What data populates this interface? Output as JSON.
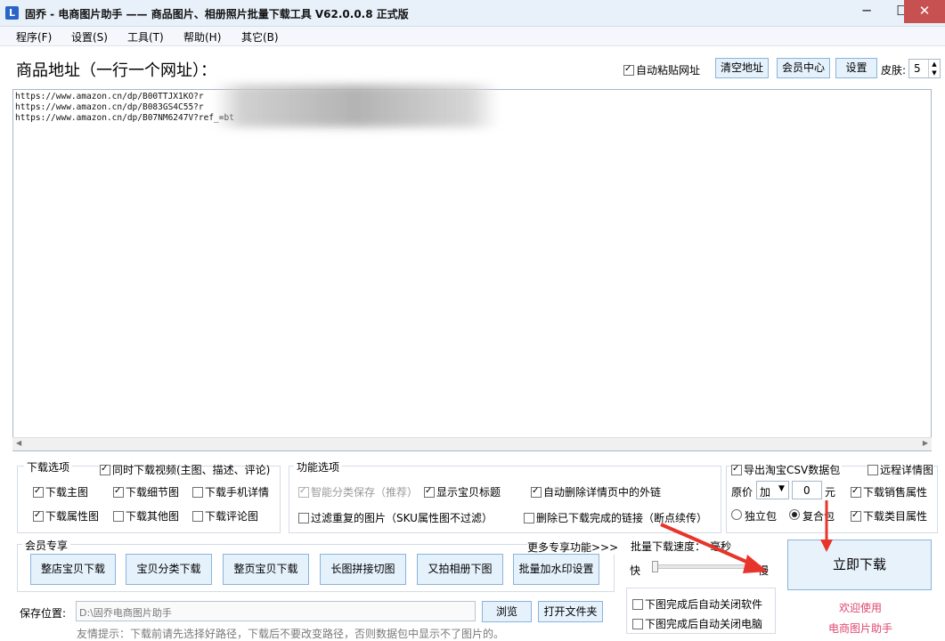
{
  "window": {
    "icon_letter": "L",
    "title": "固乔 - 电商图片助手 —— 商品图片、相册照片批量下载工具 V62.0.0.8 正式版",
    "minimize": "─",
    "maximize": "☐",
    "close": "✕"
  },
  "menu": [
    "程序(F)",
    "设置(S)",
    "工具(T)",
    "帮助(H)",
    "其它(B)"
  ],
  "url_section": {
    "label": "商品地址（一行一个网址）：",
    "auto_paste_label": "自动粘贴网址",
    "auto_paste_checked": true,
    "clear_button": "清空地址",
    "member_button": "会员中心",
    "settings_button": "设置",
    "skin_label": "皮肤:",
    "skin_value": "5",
    "urls": [
      "https://www.amazon.cn/dp/B00TTJX1KO?r",
      "https://www.amazon.cn/dp/B083GS4C55?r",
      "https://www.amazon.cn/dp/B07NM6247V?ref_=bt"
    ]
  },
  "download_options": {
    "title": "下载选项",
    "items": [
      {
        "label": "同时下载视频(主图、描述、评论)",
        "checked": true
      },
      {
        "label": "下载主图",
        "checked": true
      },
      {
        "label": "下载细节图",
        "checked": true
      },
      {
        "label": "下载手机详情",
        "checked": false
      },
      {
        "label": "下载属性图",
        "checked": true
      },
      {
        "label": "下载其他图",
        "checked": false
      },
      {
        "label": "下载评论图",
        "checked": false
      }
    ]
  },
  "function_options": {
    "title": "功能选项",
    "items": [
      {
        "label": "智能分类保存（推荐）",
        "checked": true,
        "disabled": true
      },
      {
        "label": "显示宝贝标题",
        "checked": true
      },
      {
        "label": "自动删除详情页中的外链",
        "checked": true
      },
      {
        "label": "过滤重复的图片（SKU属性图不过滤）",
        "checked": false
      },
      {
        "label": "删除已下载完成的链接（断点续传）",
        "checked": false
      }
    ]
  },
  "export_options": {
    "export_csv": {
      "label": "导出淘宝CSV数据包",
      "checked": true
    },
    "remote_detail": {
      "label": "远程详情图",
      "checked": false
    },
    "price_label": "原价",
    "price_op": "加",
    "price_value": "0",
    "price_unit": "元",
    "sales_attr": {
      "label": "下载销售属性",
      "checked": true
    },
    "standalone": {
      "label": "独立包",
      "selected": false
    },
    "composite": {
      "label": "复合包",
      "selected": true
    },
    "category_attr": {
      "label": "下载类目属性",
      "checked": true
    }
  },
  "member_section": {
    "title": "会员专享",
    "more_link": "更多专享功能>>>",
    "buttons": [
      "整店宝贝下载",
      "宝贝分类下载",
      "整页宝贝下载",
      "长图拼接切图",
      "又拍相册下图",
      "批量加水印设置"
    ]
  },
  "speed_section": {
    "title": "批量下载速度：",
    "unit_text": "毫秒",
    "fast": "快",
    "slow": "慢",
    "close_software": {
      "label": "下图完成后自动关闭软件",
      "checked": false
    },
    "close_computer": {
      "label": "下图完成后自动关闭电脑",
      "checked": false
    }
  },
  "download_button": "立即下载",
  "welcome": [
    "欢迎使用",
    "电商图片助手"
  ],
  "save_section": {
    "label": "保存位置:",
    "path": "D:\\固乔电商图片助手",
    "browse": "浏览",
    "open_folder": "打开文件夹",
    "hint": "友情提示：下载前请先选择好路径，下载后不要改变路径，否则数据包中显示不了图片的。"
  },
  "colors": {
    "accent_arrow": "#e8352c",
    "welcome_text": "#e0456e",
    "button_bg": "#e5f1fb"
  }
}
